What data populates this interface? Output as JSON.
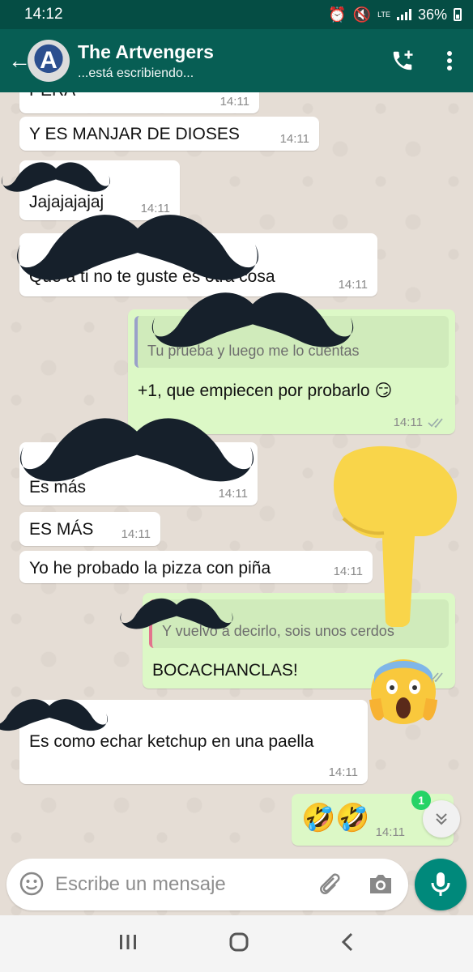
{
  "status_bar": {
    "time": "14:12",
    "network": "LTE",
    "battery": "36%"
  },
  "header": {
    "title": "The Artvengers",
    "subtitle": "...está escribiendo...",
    "avatar_letter": "A"
  },
  "messages": {
    "m1": {
      "text": "PERA",
      "time": "14:11"
    },
    "m2": {
      "text": "Y ES MANJAR DE DIOSES",
      "time": "14:11"
    },
    "m3": {
      "text": "Jajajajajaj",
      "time": "14:11"
    },
    "m4": {
      "text": "Que a ti no te guste es otra cosa",
      "time": "14:11"
    },
    "m5": {
      "quote": "Tu prueba y luego me lo cuentas",
      "text": "+1, que empiecen por probarlo 😏",
      "time": "14:11"
    },
    "m6": {
      "text": "Es más",
      "time": "14:11"
    },
    "m7": {
      "text": "ES MÁS",
      "time": "14:11"
    },
    "m8": {
      "text": "Yo he probado la pizza con piña",
      "time": "14:11"
    },
    "m9": {
      "quote": "Y vuelvo a decirlo, sois unos cerdos",
      "text": "BOCACHANCLAS!",
      "time": "14:11"
    },
    "m10": {
      "text": "Es como echar ketchup en una paella",
      "time": "14:11"
    },
    "m11": {
      "text": "🤣🤣",
      "time": "14:11"
    }
  },
  "scroll": {
    "unread_count": "1"
  },
  "input": {
    "placeholder": "Escribe un mensaje"
  },
  "colors": {
    "header": "#075e54",
    "status": "#054d44",
    "outgoing": "#dcf8c6",
    "incoming": "#ffffff",
    "accent": "#00897b"
  }
}
